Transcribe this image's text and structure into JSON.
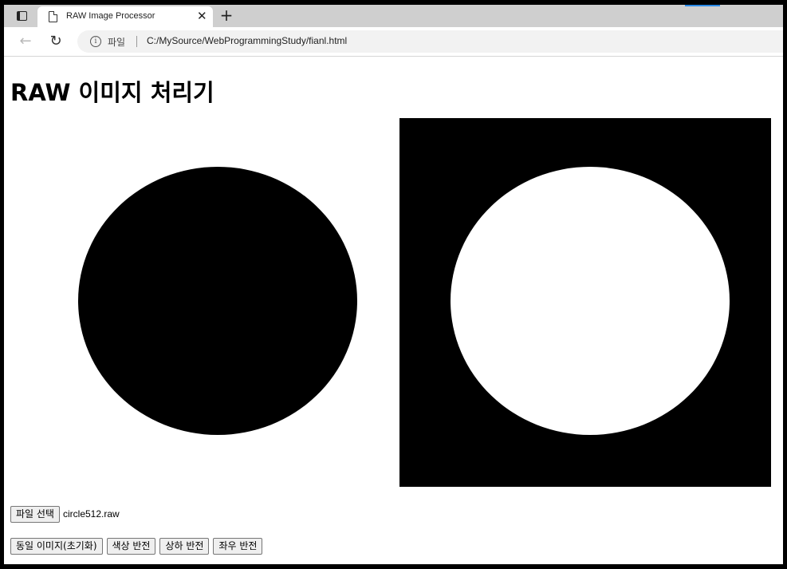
{
  "browser": {
    "tab_title": "RAW Image Processor",
    "tab_close": "✕",
    "new_tab": "+",
    "address": {
      "scheme_label": "파일",
      "url": "C:/MySource/WebProgrammingStudy/fianl.html"
    },
    "icons": {
      "tab_actions": "tab-actions-icon",
      "tab_page": "document-icon",
      "back": "back-arrow-icon",
      "reload": "reload-icon",
      "info": "info-icon"
    },
    "accent_color": "#2b8ae6"
  },
  "page": {
    "title": "RAW 이미지 처리기",
    "images": {
      "original": {
        "background": "#ffffff",
        "shape": "circle",
        "shape_color": "#000000"
      },
      "processed": {
        "background": "#000000",
        "shape": "circle",
        "shape_color": "#ffffff"
      }
    },
    "file_input": {
      "button_label": "파일 선택",
      "file_name": "circle512.raw"
    },
    "actions": [
      {
        "label": "동일 이미지(초기화)"
      },
      {
        "label": "색상 반전"
      },
      {
        "label": "상하 반전"
      },
      {
        "label": "좌우 반전"
      }
    ]
  }
}
